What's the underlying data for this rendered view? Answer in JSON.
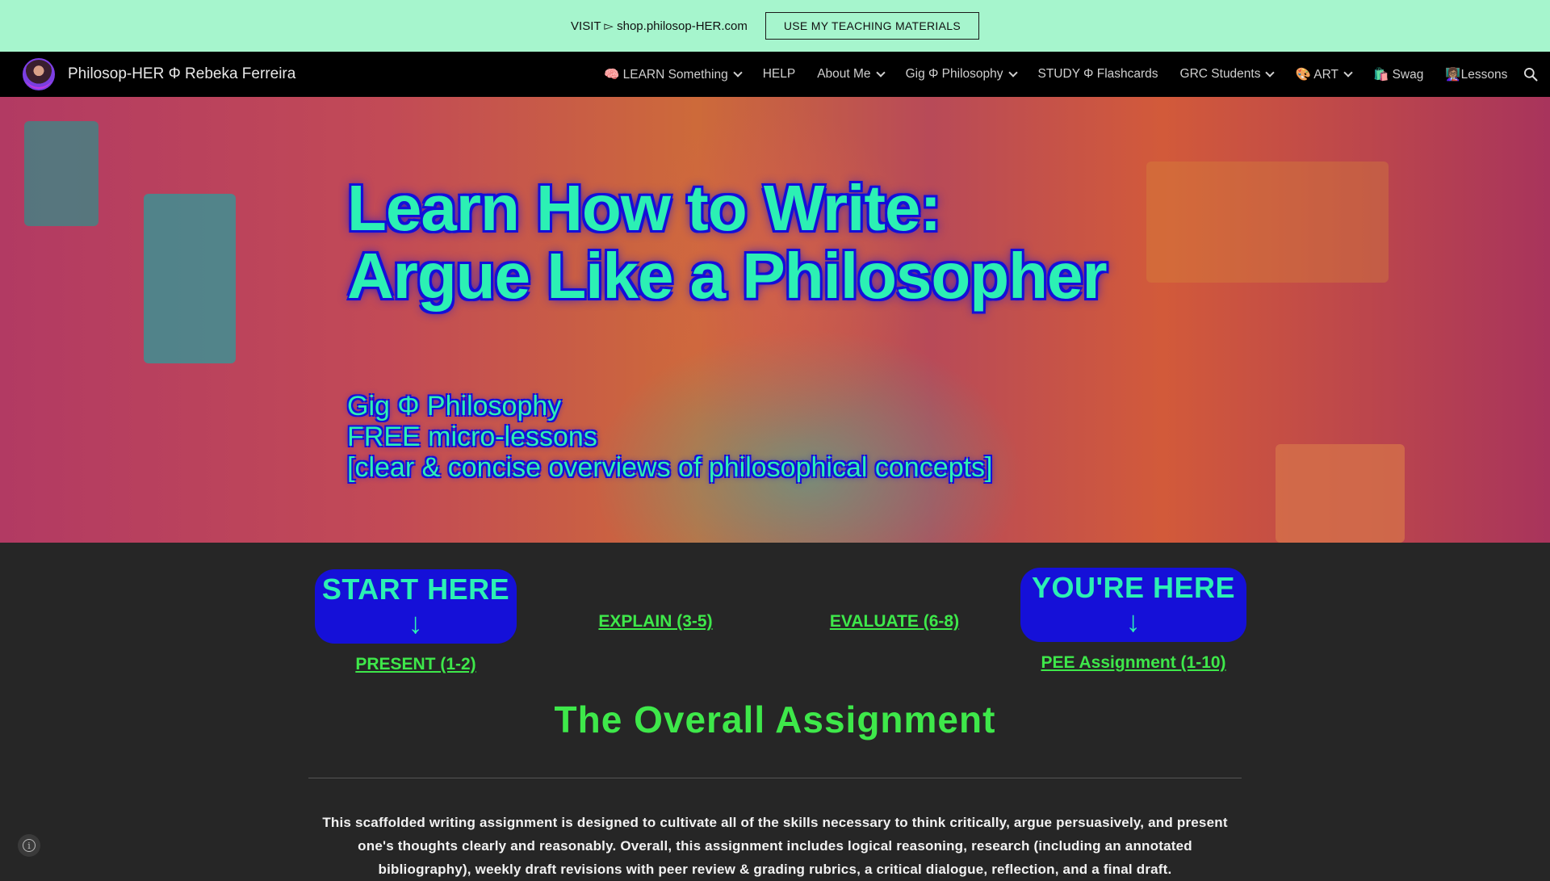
{
  "announcement": {
    "text": "VISIT ▻ shop.philosop-HER.com",
    "button_label": "USE MY TEACHING MATERIALS"
  },
  "header": {
    "site_title": "Philosop-HER Φ Rebeka Ferreira",
    "nav": [
      {
        "label": "🧠 LEARN Something",
        "has_dropdown": true
      },
      {
        "label": "HELP",
        "has_dropdown": false
      },
      {
        "label": "About Me",
        "has_dropdown": true
      },
      {
        "label": "Gig Φ Philosophy",
        "has_dropdown": true
      },
      {
        "label": "STUDY Φ Flashcards",
        "has_dropdown": false
      },
      {
        "label": "GRC Students",
        "has_dropdown": true
      },
      {
        "label": "🎨 ART",
        "has_dropdown": true
      },
      {
        "label": "🛍️ Swag",
        "has_dropdown": false
      },
      {
        "label": "👩🏽‍🏫Lessons",
        "has_dropdown": false
      }
    ],
    "search_icon": "search-icon"
  },
  "hero": {
    "title_line1": "Learn How to Write:",
    "title_line2": "Argue Like a Philosopher",
    "subtitle_line1": "Gig Φ Philosophy",
    "subtitle_line2": "FREE micro-lessons",
    "subtitle_line3": "[clear & concise overviews of philosophical concepts]"
  },
  "steps": {
    "start_badge": "START HERE ↓",
    "here_badge": "YOU'RE HERE ↓",
    "links": [
      "PRESENT (1-2)",
      "EXPLAIN (3-5)",
      "EVALUATE (6-8)",
      "PEE Assignment (1-10)"
    ]
  },
  "section": {
    "title": "The Overall Assignment",
    "body": "This scaffolded writing assignment is designed to cultivate all of the skills necessary to think critically, argue persuasively, and present one's thoughts clearly and reasonably. Overall, this assignment includes logical reasoning, research (including an annotated bibliography), weekly draft revisions with peer review & grading rubrics, a critical dialogue, reflection, and a final draft."
  },
  "colors": {
    "announcement_bg": "#a6f5cd",
    "nav_bg": "#000000",
    "page_bg": "#262626",
    "accent_green": "#3ee84a",
    "hero_text": "#2cf0b4",
    "hero_outline": "#1510d8"
  }
}
